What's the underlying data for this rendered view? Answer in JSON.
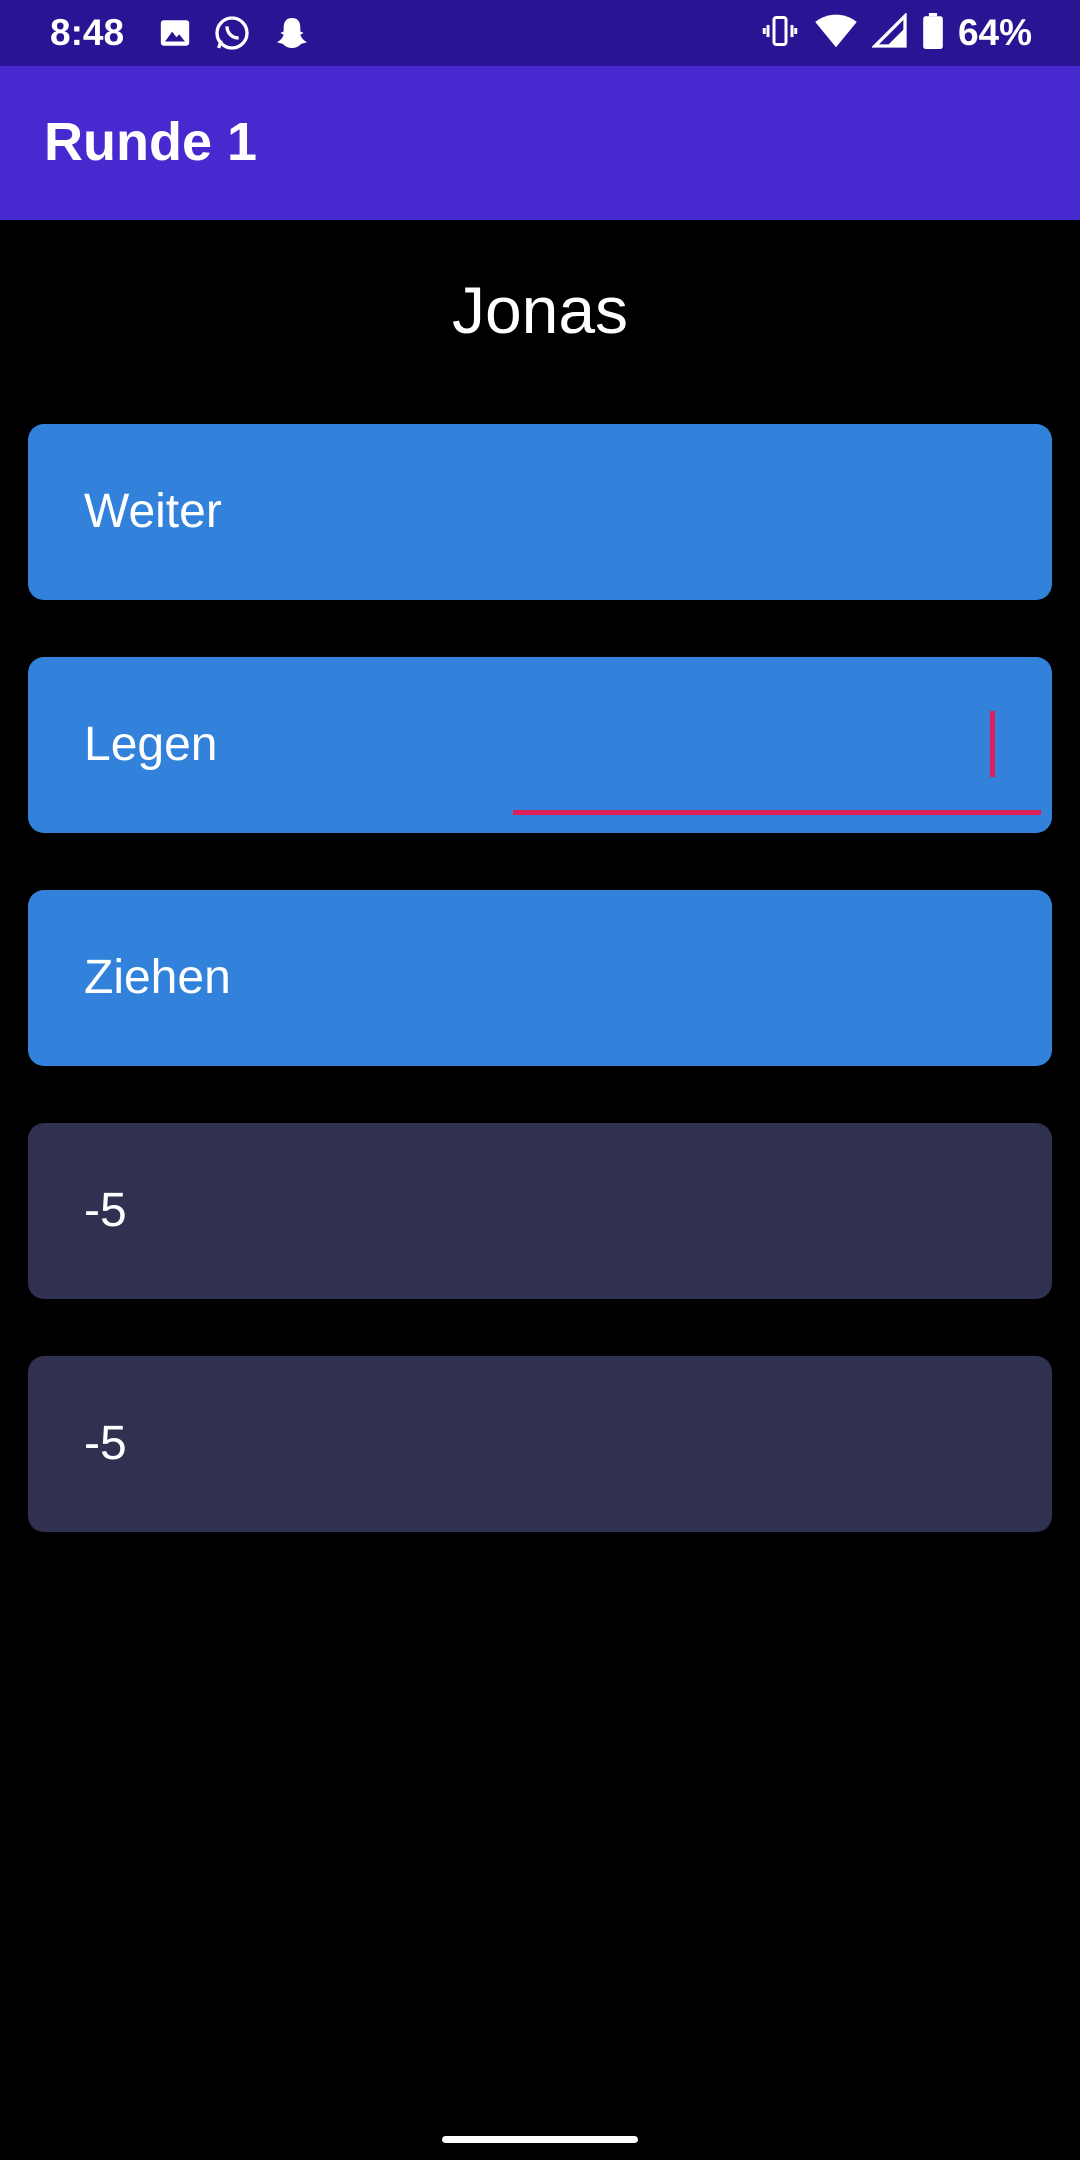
{
  "status_bar": {
    "time": "8:48",
    "battery_percent": "64%",
    "left_icons": [
      "image-icon",
      "whatsapp-icon",
      "snapchat-icon"
    ],
    "right_icons": [
      "vibrate-icon",
      "wifi-icon",
      "signal-icon",
      "battery-icon"
    ],
    "background": "#281593"
  },
  "app_bar": {
    "title": "Runde 1",
    "background": "#4828cf"
  },
  "player": {
    "name": "Jonas"
  },
  "fields": [
    {
      "label": "Weiter",
      "style": "blue"
    },
    {
      "label": "Legen",
      "style": "blue",
      "focused": true
    },
    {
      "label": "Ziehen",
      "style": "blue"
    },
    {
      "label": "-5",
      "style": "dark"
    },
    {
      "label": "-5",
      "style": "dark"
    }
  ],
  "colors": {
    "accent_blue": "#3282dc",
    "input_dark": "#303150",
    "focus_pink": "#e0205a"
  }
}
